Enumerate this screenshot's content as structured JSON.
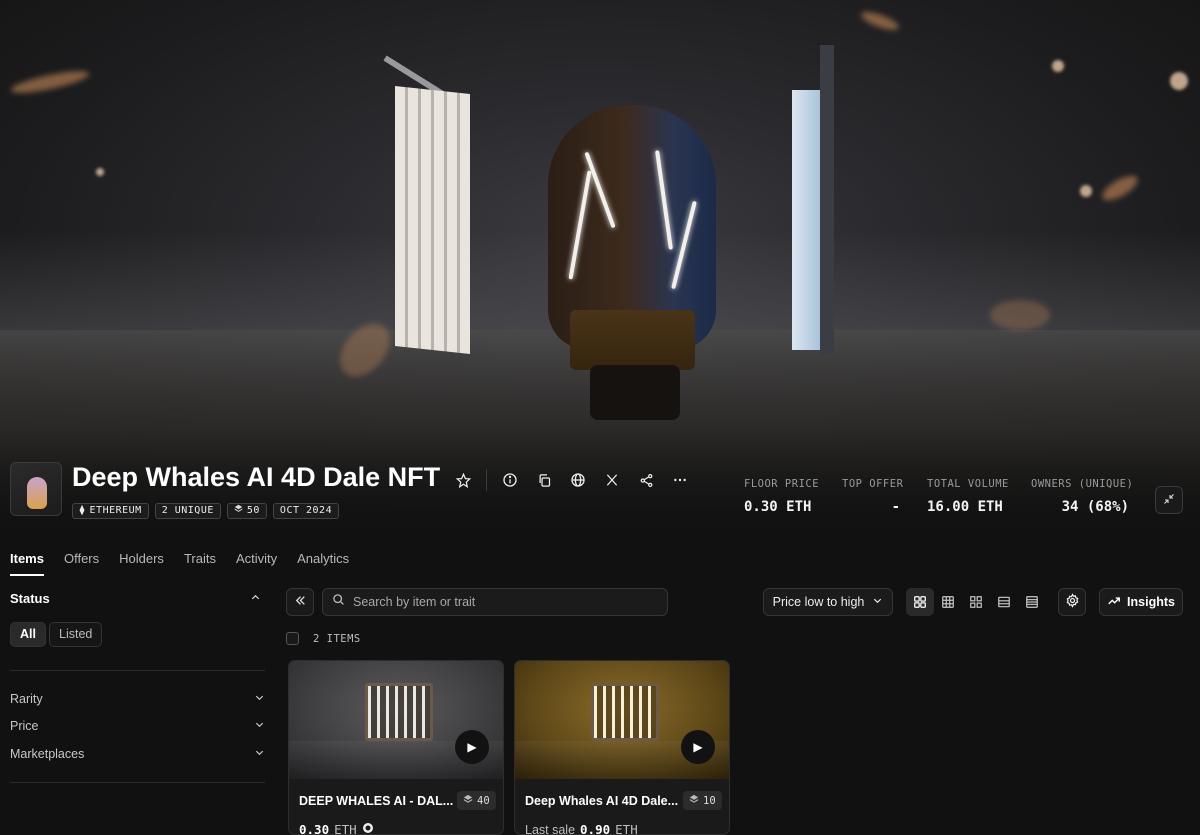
{
  "collection": {
    "name": "Deep Whales AI 4D Dale NFT",
    "chips": {
      "chain": "ETHEREUM",
      "unique": "2 UNIQUE",
      "supply": "50",
      "date": "OCT 2024"
    }
  },
  "header_icons": [
    "star-icon",
    "info-icon",
    "copy-icon",
    "globe-icon",
    "x-icon",
    "share-icon",
    "more-icon"
  ],
  "stats": [
    {
      "label": "FLOOR PRICE",
      "value": "0.30 ETH"
    },
    {
      "label": "TOP OFFER",
      "value": "-"
    },
    {
      "label": "TOTAL VOLUME",
      "value": "16.00 ETH"
    },
    {
      "label": "OWNERS (UNIQUE)",
      "value": "34 (68%)"
    }
  ],
  "tabs": [
    "Items",
    "Offers",
    "Holders",
    "Traits",
    "Activity",
    "Analytics"
  ],
  "sidebar": {
    "status_title": "Status",
    "status_options": [
      "All",
      "Listed"
    ],
    "filters": [
      "Rarity",
      "Price",
      "Marketplaces"
    ]
  },
  "toolbar": {
    "search_placeholder": "Search by item or trait",
    "sort_label": "Price low to high",
    "insights_label": "Insights"
  },
  "items_count": "2 ITEMS",
  "cards": [
    {
      "name": "DEEP WHALES AI - DAL...",
      "count": "40",
      "price_value": "0.30",
      "price_unit": "ETH",
      "prefix": ""
    },
    {
      "name": "Deep Whales AI 4D Dale...",
      "count": "10",
      "price_value": "0.90",
      "price_unit": "ETH",
      "prefix": "Last sale"
    }
  ]
}
